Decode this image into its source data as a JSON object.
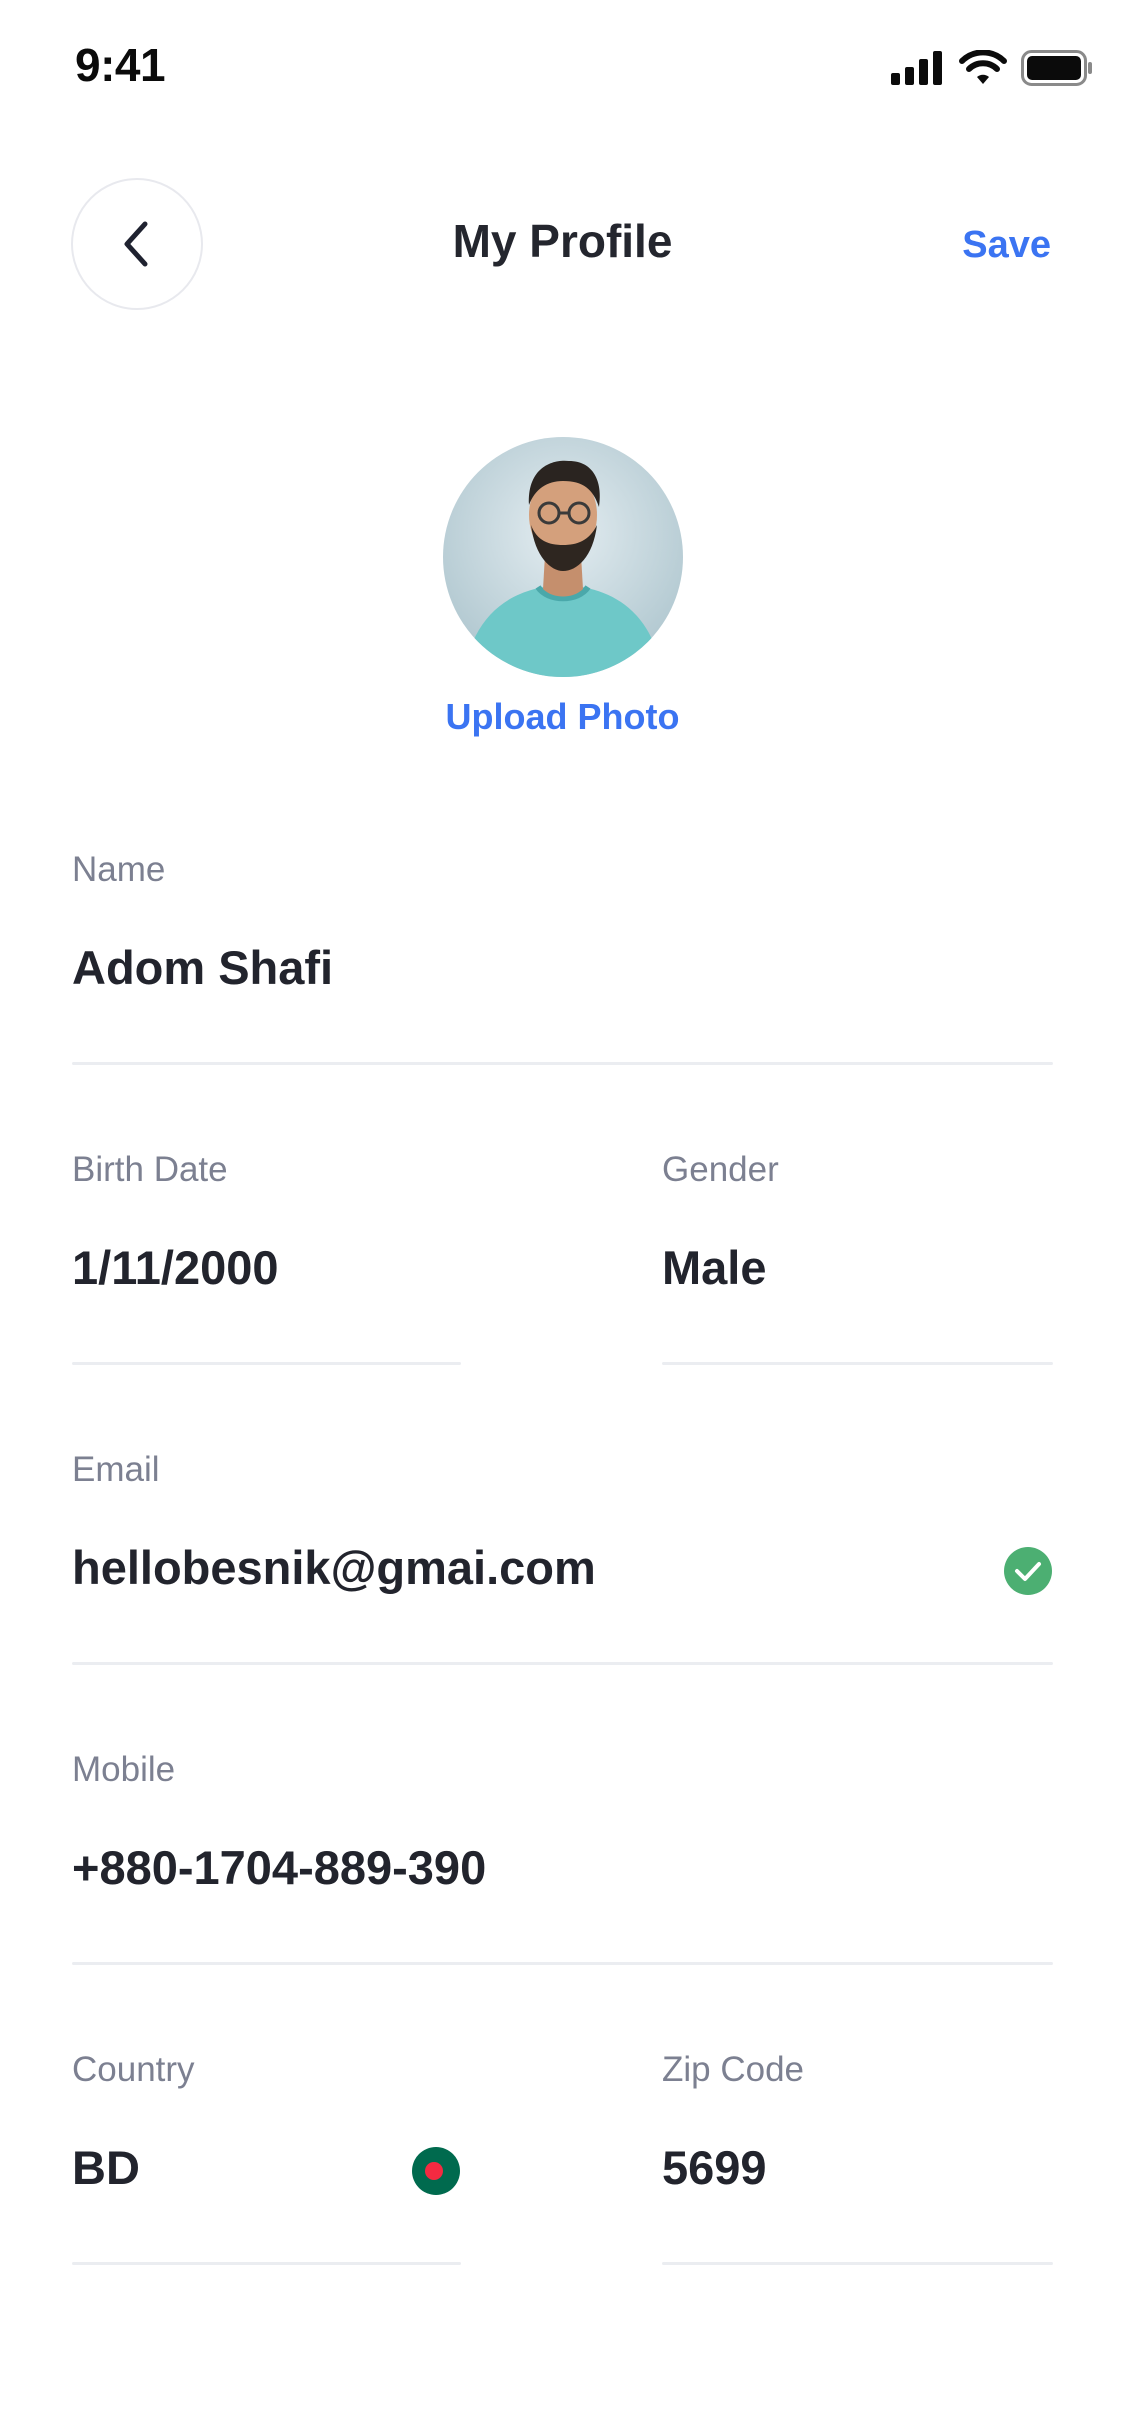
{
  "status_bar": {
    "time": "9:41"
  },
  "header": {
    "title": "My Profile",
    "save_label": "Save"
  },
  "profile": {
    "upload_label": "Upload Photo"
  },
  "fields": {
    "name": {
      "label": "Name",
      "value": "Adom Shafi"
    },
    "birth_date": {
      "label": "Birth Date",
      "value": "1/11/2000"
    },
    "gender": {
      "label": "Gender",
      "value": "Male"
    },
    "email": {
      "label": "Email",
      "value": "hellobesnik@gmai.com",
      "status_icon": "check-circle-icon"
    },
    "mobile": {
      "label": "Mobile",
      "value": "+880-1704-889-390"
    },
    "country": {
      "label": "Country",
      "value": "BD",
      "flag_icon": "bangladesh-flag-icon"
    },
    "zip_code": {
      "label": "Zip Code",
      "value": "5699"
    }
  },
  "colors": {
    "accent": "#3b74f2",
    "verified": "#4caf72",
    "flag_green": "#006a4e",
    "flag_red": "#f42a41"
  }
}
